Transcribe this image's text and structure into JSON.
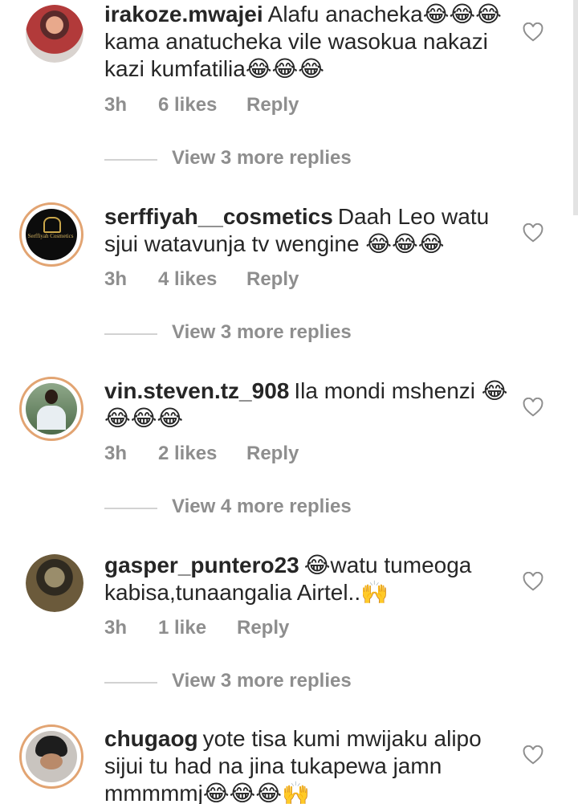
{
  "comments": [
    {
      "username": "irakoze.mwajei",
      "text": "Alafu anacheka😂😂😂 kama anatucheka vile wasokua nakazi kazi kumfatilia😂😂😂",
      "time": "3h",
      "likes": "6 likes",
      "reply": "Reply",
      "view_replies": "View 3 more replies"
    },
    {
      "username": "serffiyah__cosmetics",
      "text": "Daah Leo watu sjui watavunja tv wengine 😂😂😂",
      "time": "3h",
      "likes": "4 likes",
      "reply": "Reply",
      "view_replies": "View 3 more replies",
      "avatar_text": "Serffiyah Cosmetics"
    },
    {
      "username": "vin.steven.tz_908",
      "text": "Ila mondi mshenzi 😂😂😂😂",
      "time": "3h",
      "likes": "2 likes",
      "reply": "Reply",
      "view_replies": "View 4 more replies"
    },
    {
      "username": "gasper_puntero23",
      "text": "😂watu tumeoga kabisa,tunaangalia Airtel..🙌",
      "time": "3h",
      "likes": "1 like",
      "reply": "Reply",
      "view_replies": "View 3 more replies"
    },
    {
      "username": "chugaog",
      "text": "yote tisa kumi mwijaku alipo sijui tu had na jina tukapewa jamn mmmmmj😂😂😂🙌",
      "time": "",
      "likes": "",
      "reply": "",
      "view_replies": ""
    }
  ],
  "colors": {
    "text": "#262626",
    "meta": "#8e8e8e",
    "story_ring": "#e2a472",
    "divider": "#d2d2d2"
  },
  "icons": {
    "like": "heart-outline-icon"
  }
}
